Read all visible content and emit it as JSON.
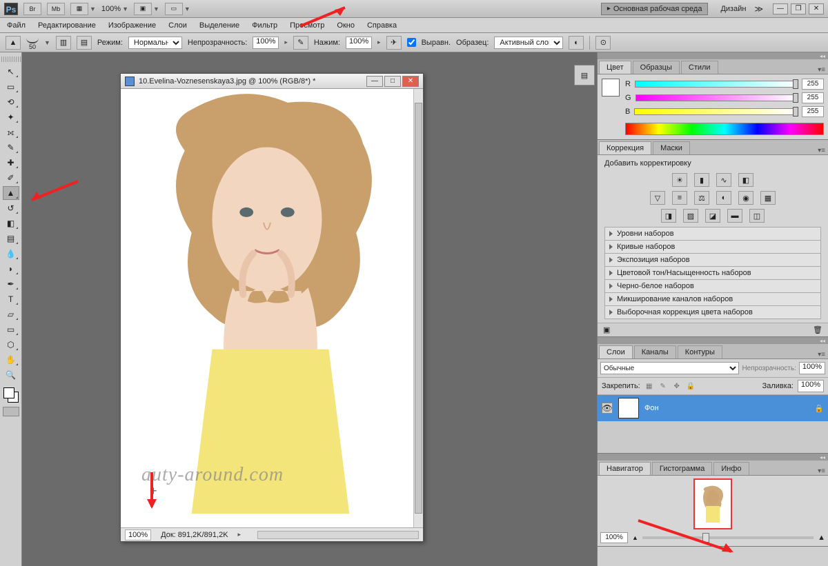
{
  "topbar": {
    "zoom": "100%",
    "workspace": "Основная рабочая среда",
    "design": "Дизайн"
  },
  "menu": [
    "Файл",
    "Редактирование",
    "Изображение",
    "Слои",
    "Выделение",
    "Фильтр",
    "Просмотр",
    "Окно",
    "Справка"
  ],
  "options": {
    "brush_size": "50",
    "mode_label": "Режим:",
    "mode_value": "Нормальный",
    "opacity_label": "Непрозрачность:",
    "opacity_value": "100%",
    "flow_label": "Нажим:",
    "flow_value": "100%",
    "align_label": "Выравн.",
    "sample_label": "Образец:",
    "sample_value": "Активный слой"
  },
  "document": {
    "title": "10.Evelina-Voznesenskaya3.jpg @ 100% (RGB/8*) *",
    "zoom": "100%",
    "docinfo": "Док: 891,2K/891,2K",
    "watermark": "auty-around.com"
  },
  "color_panel": {
    "tabs": [
      "Цвет",
      "Образцы",
      "Стили"
    ],
    "channels": [
      {
        "l": "R",
        "v": "255"
      },
      {
        "l": "G",
        "v": "255"
      },
      {
        "l": "B",
        "v": "255"
      }
    ]
  },
  "adjust_panel": {
    "tabs": [
      "Коррекция",
      "Маски"
    ],
    "title": "Добавить корректировку",
    "items": [
      "Уровни наборов",
      "Кривые наборов",
      "Экспозиция наборов",
      "Цветовой тон/Насыщенность наборов",
      "Черно-белое наборов",
      "Микширование каналов наборов",
      "Выборочная коррекция цвета наборов"
    ]
  },
  "layers_panel": {
    "tabs": [
      "Слои",
      "Каналы",
      "Контуры"
    ],
    "blend": "Обычные",
    "opacity_label": "Непрозрачность:",
    "opacity_value": "100%",
    "lock_label": "Закрепить:",
    "fill_label": "Заливка:",
    "fill_value": "100%",
    "layer_name": "Фон"
  },
  "nav_panel": {
    "tabs": [
      "Навигатор",
      "Гистограмма",
      "Инфо"
    ],
    "zoom": "100%"
  }
}
